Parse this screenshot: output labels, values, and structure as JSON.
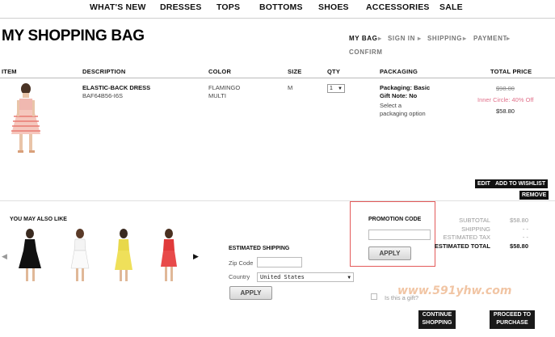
{
  "nav": {
    "items": [
      "WHAT'S NEW",
      "DRESSES",
      "TOPS",
      "BOTTOMS",
      "SHOES",
      "ACCESSORIES",
      "SALE"
    ]
  },
  "page_title": "MY SHOPPING BAG",
  "steps": {
    "items": [
      "MY BAG",
      "SIGN IN",
      "SHIPPING",
      "PAYMENT",
      "CONFIRM"
    ],
    "separator": "▸"
  },
  "table": {
    "headers": [
      "ITEM",
      "DESCRIPTION",
      "COLOR",
      "SIZE",
      "QTY",
      "PACKAGING",
      "TOTAL PRICE"
    ],
    "row": {
      "name": "ELASTIC-BACK DRESS",
      "sku": "BAF64B56-I6S",
      "color_line1": "FLAMINGO",
      "color_line2": "MULTI",
      "size": "M",
      "qty": "1",
      "packaging": "Packaging: Basic",
      "gift_note": "Gift Note: No",
      "packaging_link_1": "Select a",
      "packaging_link_2": "packaging option",
      "price_original": "$98.00",
      "price_discount_label": "Inner Circle: 40% Off",
      "price_final": "$58.80"
    },
    "actions": {
      "edit": "EDIT",
      "wishlist": "ADD TO WISHLIST",
      "remove": "REMOVE"
    }
  },
  "also_like": {
    "title": "YOU MAY ALSO LIKE"
  },
  "shipping": {
    "title": "ESTIMATED SHIPPING",
    "zip_label": "Zip Code",
    "country_label": "Country",
    "country_value": "United States",
    "apply": "APPLY"
  },
  "promo": {
    "title": "PROMOTION CODE",
    "apply": "APPLY"
  },
  "summary": {
    "subtotal_label": "SUBTOTAL",
    "subtotal_value": "$58.80",
    "shipping_label": "SHIPPING",
    "shipping_value": "- -",
    "tax_label": "ESTIMATED TAX",
    "tax_value": "- -",
    "total_label": "ESTIMATED TOTAL",
    "total_value": "$58.80"
  },
  "gift": {
    "label": "Is this a gift?"
  },
  "checkout": {
    "continue_1": "CONTINUE",
    "continue_2": "SHOPPING",
    "proceed_1": "PROCEED TO",
    "proceed_2": "PURCHASE"
  },
  "watermark": {
    "url": "www.591yhw.com"
  },
  "colors": {
    "promo_border": "#e35a5a",
    "discount": "#e0708a"
  }
}
